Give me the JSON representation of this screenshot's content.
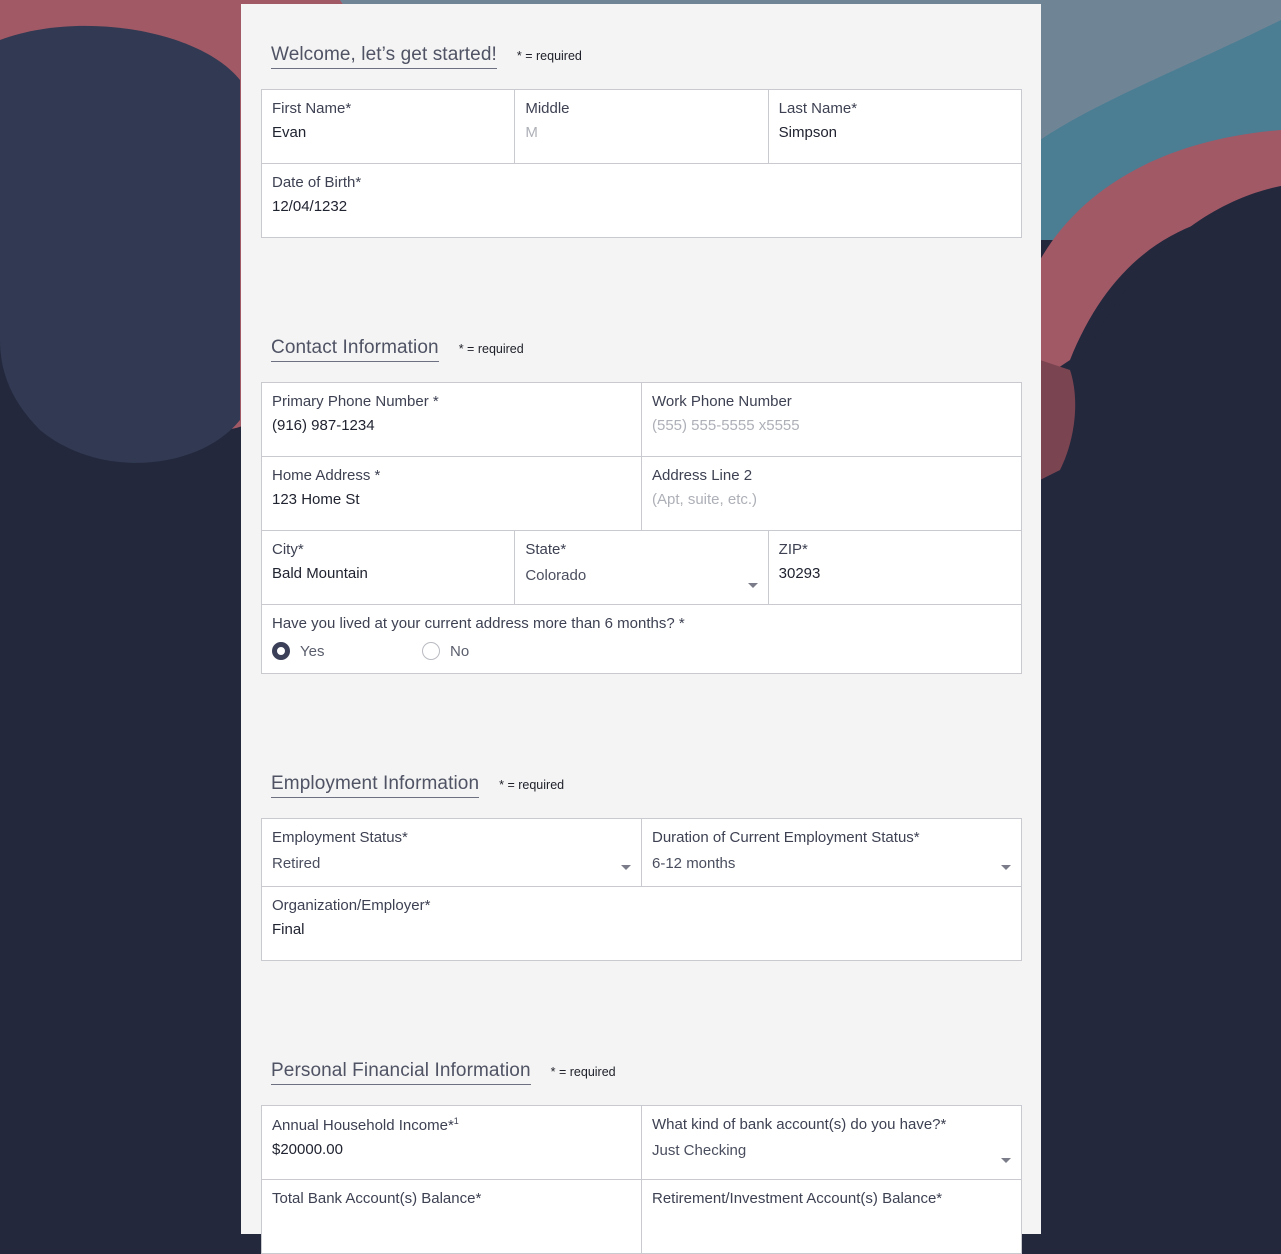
{
  "colors": {
    "background_navy": "#23283d",
    "background_slate": "#313a52",
    "background_rose": "#a25966",
    "background_teal": "#4b7d93",
    "background_steel": "#6f8596",
    "card": "#f4f4f4",
    "radio_selected": "#3b4058"
  },
  "sections": {
    "welcome": {
      "title": "Welcome, let’s get started!",
      "required_note": "* = required"
    },
    "contact": {
      "title": "Contact Information",
      "required_note": "* = required"
    },
    "employment": {
      "title": "Employment Information",
      "required_note": "* = required"
    },
    "financial": {
      "title": "Personal Financial Information",
      "required_note": "* = required"
    }
  },
  "fields": {
    "first_name": {
      "label": "First Name*",
      "value": "Evan"
    },
    "middle": {
      "label": "Middle",
      "placeholder": "M"
    },
    "last_name": {
      "label": "Last Name*",
      "value": "Simpson"
    },
    "dob": {
      "label": "Date of Birth*",
      "value": "12/04/1232"
    },
    "primary_phone": {
      "label": "Primary Phone Number *",
      "value": "(916) 987-1234"
    },
    "work_phone": {
      "label": "Work Phone Number",
      "placeholder": "(555) 555-5555 x5555"
    },
    "home_address": {
      "label": "Home Address *",
      "value": "123 Home St"
    },
    "address_line_2": {
      "label": "Address Line 2",
      "placeholder": "(Apt, suite, etc.)"
    },
    "city": {
      "label": "City*",
      "value": "Bald Mountain"
    },
    "state": {
      "label": "State*",
      "value": "Colorado"
    },
    "zip": {
      "label": "ZIP*",
      "value": "30293"
    },
    "lived_6_months": {
      "label": "Have you lived at your current address more than 6 months? *",
      "options": [
        "Yes",
        "No"
      ],
      "selected": "Yes"
    },
    "employment_status": {
      "label": "Employment Status*",
      "value": "Retired"
    },
    "employment_duration": {
      "label": "Duration of Current Employment Status*",
      "value": "6-12 months"
    },
    "employer": {
      "label": "Organization/Employer*",
      "value": "Final"
    },
    "income": {
      "label": "Annual Household Income*",
      "superscript": "1",
      "value": "$20000.00"
    },
    "bank_accounts": {
      "label": "What kind of bank account(s) do you have?*",
      "value": "Just Checking"
    },
    "bank_balance": {
      "label": "Total Bank Account(s) Balance*"
    },
    "retirement_balance": {
      "label": "Retirement/Investment Account(s) Balance*"
    }
  },
  "icons": {
    "select_caret": "chevron-down-icon"
  }
}
